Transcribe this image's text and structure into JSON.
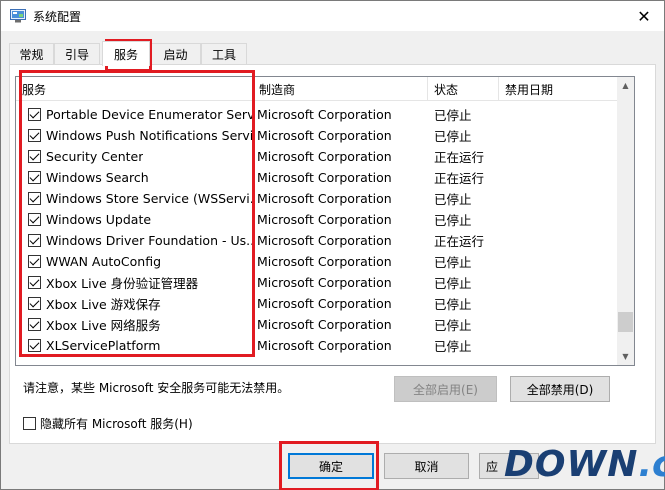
{
  "window": {
    "title": "系统配置",
    "close_glyph": "✕"
  },
  "tabs": [
    {
      "label": "常规",
      "active": false
    },
    {
      "label": "引导",
      "active": false
    },
    {
      "label": "服务",
      "active": true
    },
    {
      "label": "启动",
      "active": false
    },
    {
      "label": "工具",
      "active": false
    }
  ],
  "services_table": {
    "columns": [
      "服务",
      "制造商",
      "状态",
      "禁用日期"
    ],
    "rows": [
      {
        "name": "Portable Device Enumerator Serv...",
        "manufacturer": "Microsoft Corporation",
        "status": "已停止",
        "checked": true
      },
      {
        "name": "Windows Push Notifications Servi...",
        "manufacturer": "Microsoft Corporation",
        "status": "已停止",
        "checked": true
      },
      {
        "name": "Security Center",
        "manufacturer": "Microsoft Corporation",
        "status": "正在运行",
        "checked": true
      },
      {
        "name": "Windows Search",
        "manufacturer": "Microsoft Corporation",
        "status": "正在运行",
        "checked": true
      },
      {
        "name": "Windows Store Service (WSServi...",
        "manufacturer": "Microsoft Corporation",
        "status": "已停止",
        "checked": true
      },
      {
        "name": "Windows Update",
        "manufacturer": "Microsoft Corporation",
        "status": "已停止",
        "checked": true
      },
      {
        "name": "Windows Driver Foundation - Us...",
        "manufacturer": "Microsoft Corporation",
        "status": "正在运行",
        "checked": true
      },
      {
        "name": "WWAN AutoConfig",
        "manufacturer": "Microsoft Corporation",
        "status": "已停止",
        "checked": true
      },
      {
        "name": "Xbox Live 身份验证管理器",
        "manufacturer": "Microsoft Corporation",
        "status": "已停止",
        "checked": true
      },
      {
        "name": "Xbox Live 游戏保存",
        "manufacturer": "Microsoft Corporation",
        "status": "已停止",
        "checked": true
      },
      {
        "name": "Xbox Live 网络服务",
        "manufacturer": "Microsoft Corporation",
        "status": "已停止",
        "checked": true
      },
      {
        "name": "XLServicePlatform",
        "manufacturer": "Microsoft Corporation",
        "status": "已停止",
        "checked": true
      }
    ],
    "scroll_position_fraction": 0.93
  },
  "note": "请注意，某些 Microsoft 安全服务可能无法禁用。",
  "buttons": {
    "enable_all": "全部启用(E)",
    "disable_all": "全部禁用(D)",
    "ok": "确定",
    "cancel": "取消",
    "apply": "应"
  },
  "hide_ms_checkbox": {
    "label": "隐藏所有 Microsoft 服务(H)",
    "checked": false
  },
  "watermark": {
    "left": "DOWN",
    "right": ".cc"
  },
  "colors": {
    "highlight_box": "#e11b22",
    "accent": "#0078d7"
  }
}
